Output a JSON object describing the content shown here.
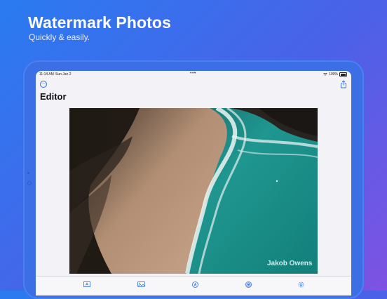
{
  "hero": {
    "title": "Watermark Photos",
    "subtitle": "Quickly & easily."
  },
  "status_bar": {
    "time": "11:14 AM",
    "date": "Sun Jan 2",
    "battery": "100%"
  },
  "editor": {
    "title": "Editor",
    "watermark_text": "Jakob Owens"
  },
  "tab_bar": {
    "icons": [
      "text-icon",
      "image-icon",
      "font-icon",
      "color-icon",
      "settings-icon"
    ]
  },
  "colors": {
    "accent": "#2f6fe8",
    "background_gradient_start": "#2a7bf0",
    "background_gradient_end": "#7f52e2"
  }
}
